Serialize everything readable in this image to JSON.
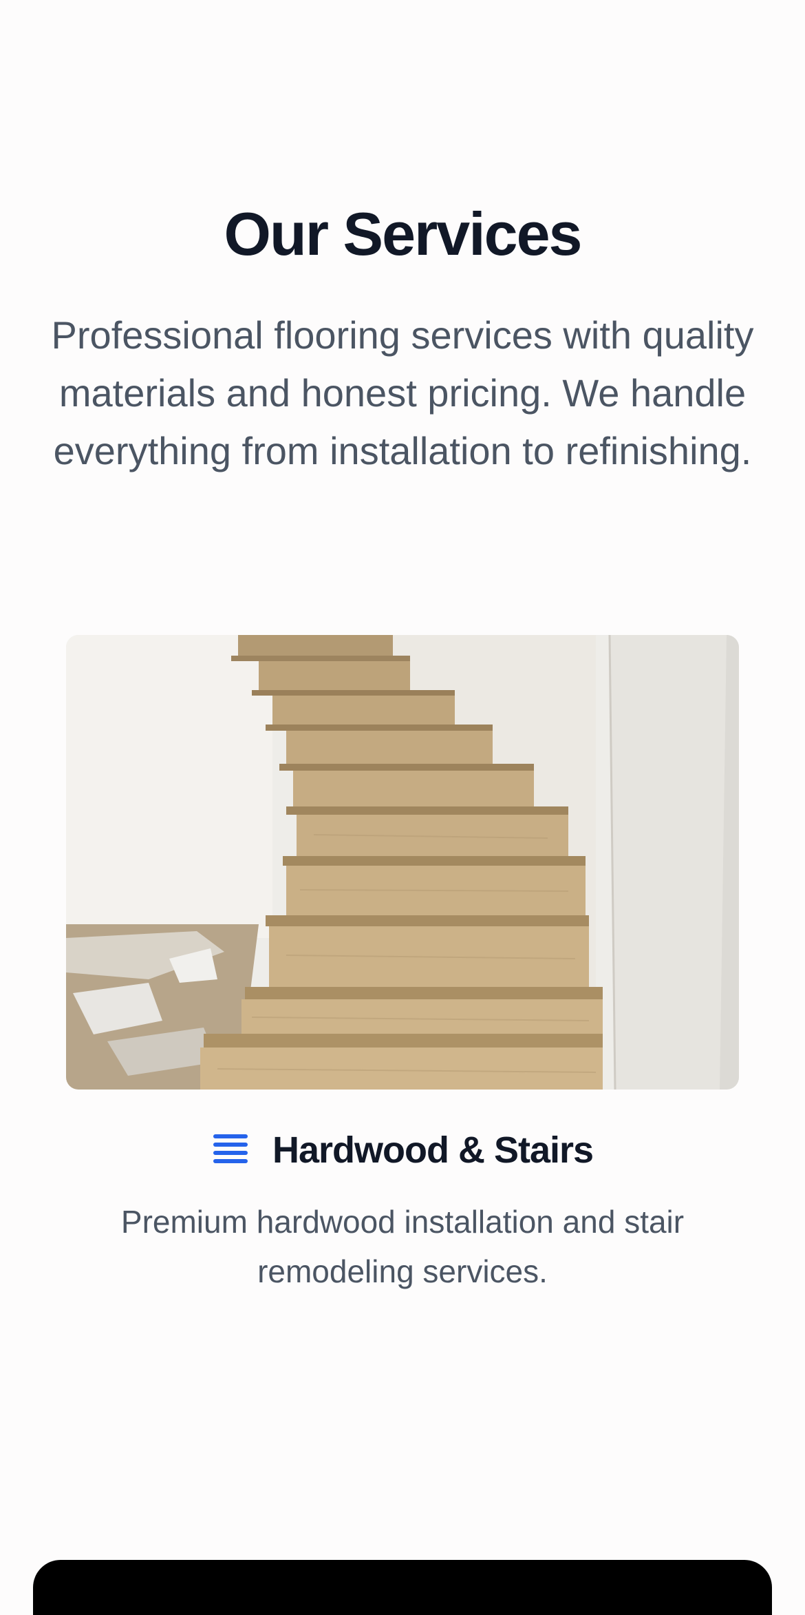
{
  "services": {
    "title": "Our Services",
    "intro": "Professional flooring services with quality materials and honest pricing. We handle everything from installation to refinishing.",
    "cards": [
      {
        "icon": "list-icon",
        "title": "Hardwood & Stairs",
        "description": "Premium hardwood installation and stair remodeling services.",
        "image": "staircase-photo"
      }
    ]
  },
  "colors": {
    "heading": "#111827",
    "body_text": "#4b5563",
    "accent": "#2563eb",
    "background": "#fdfcfc",
    "bottom_bar": "#000000"
  }
}
